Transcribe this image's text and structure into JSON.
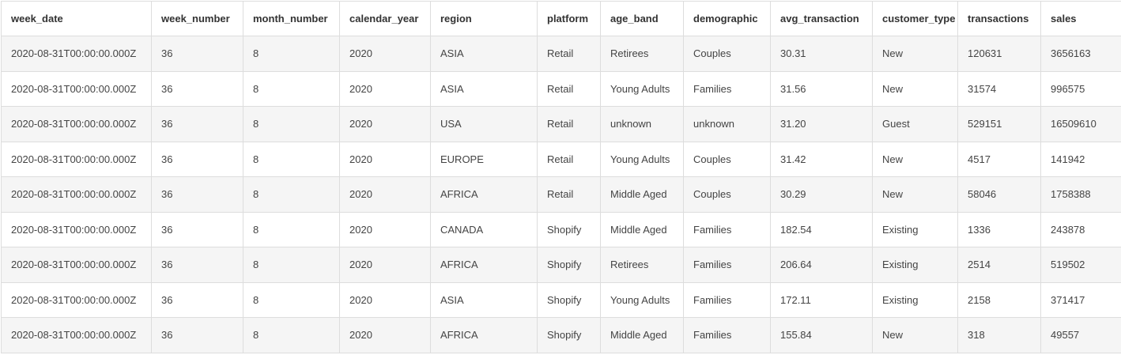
{
  "table": {
    "columns": [
      "week_date",
      "week_number",
      "month_number",
      "calendar_year",
      "region",
      "platform",
      "age_band",
      "demographic",
      "avg_transaction",
      "customer_type",
      "transactions",
      "sales"
    ],
    "rows": [
      [
        "2020-08-31T00:00:00.000Z",
        "36",
        "8",
        "2020",
        "ASIA",
        "Retail",
        "Retirees",
        "Couples",
        "30.31",
        "New",
        "120631",
        "3656163"
      ],
      [
        "2020-08-31T00:00:00.000Z",
        "36",
        "8",
        "2020",
        "ASIA",
        "Retail",
        "Young Adults",
        "Families",
        "31.56",
        "New",
        "31574",
        "996575"
      ],
      [
        "2020-08-31T00:00:00.000Z",
        "36",
        "8",
        "2020",
        "USA",
        "Retail",
        "unknown",
        "unknown",
        "31.20",
        "Guest",
        "529151",
        "16509610"
      ],
      [
        "2020-08-31T00:00:00.000Z",
        "36",
        "8",
        "2020",
        "EUROPE",
        "Retail",
        "Young Adults",
        "Couples",
        "31.42",
        "New",
        "4517",
        "141942"
      ],
      [
        "2020-08-31T00:00:00.000Z",
        "36",
        "8",
        "2020",
        "AFRICA",
        "Retail",
        "Middle Aged",
        "Couples",
        "30.29",
        "New",
        "58046",
        "1758388"
      ],
      [
        "2020-08-31T00:00:00.000Z",
        "36",
        "8",
        "2020",
        "CANADA",
        "Shopify",
        "Middle Aged",
        "Families",
        "182.54",
        "Existing",
        "1336",
        "243878"
      ],
      [
        "2020-08-31T00:00:00.000Z",
        "36",
        "8",
        "2020",
        "AFRICA",
        "Shopify",
        "Retirees",
        "Families",
        "206.64",
        "Existing",
        "2514",
        "519502"
      ],
      [
        "2020-08-31T00:00:00.000Z",
        "36",
        "8",
        "2020",
        "ASIA",
        "Shopify",
        "Young Adults",
        "Families",
        "172.11",
        "Existing",
        "2158",
        "371417"
      ],
      [
        "2020-08-31T00:00:00.000Z",
        "36",
        "8",
        "2020",
        "AFRICA",
        "Shopify",
        "Middle Aged",
        "Families",
        "155.84",
        "New",
        "318",
        "49557"
      ]
    ]
  }
}
